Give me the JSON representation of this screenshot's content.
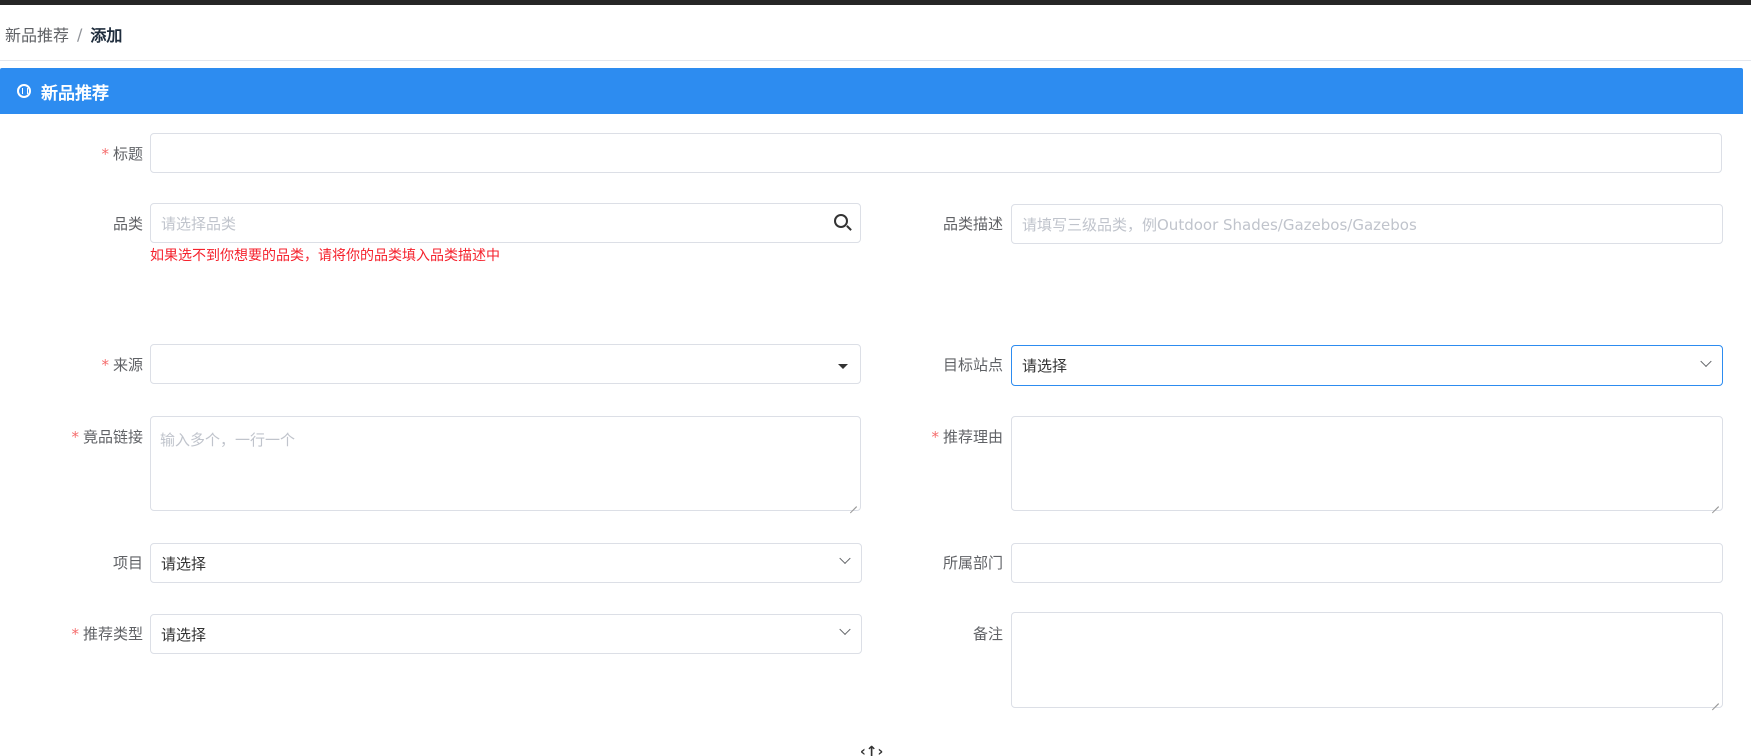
{
  "breadcrumb": {
    "parent": "新品推荐",
    "separator": "/",
    "current": "添加"
  },
  "panel": {
    "title": "新品推荐"
  },
  "form": {
    "title": {
      "label": "标题",
      "required": "*",
      "value": ""
    },
    "category": {
      "label": "品类",
      "placeholder": "请选择品类",
      "hint": "如果选不到你想要的品类，请将你的品类填入品类描述中"
    },
    "category_desc": {
      "label": "品类描述",
      "placeholder": "请填写三级品类，例Outdoor Shades/Gazebos/Gazebos"
    },
    "source": {
      "label": "来源",
      "required": "*",
      "value": ""
    },
    "target_site": {
      "label": "目标站点",
      "value": "请选择"
    },
    "competitor_links": {
      "label": "竟品链接",
      "required": "*",
      "placeholder": "输入多个，一行一个"
    },
    "reason": {
      "label": "推荐理由",
      "required": "*",
      "value": ""
    },
    "project": {
      "label": "项目",
      "value": "请选择"
    },
    "department": {
      "label": "所属部门",
      "value": ""
    },
    "recommend_type": {
      "label": "推荐类型",
      "required": "*",
      "value": "请选择"
    },
    "remark": {
      "label": "备注",
      "value": ""
    }
  },
  "colors": {
    "accent": "#2d8cf0",
    "error": "#f5222d",
    "required": "#f56c6c"
  },
  "icons": {
    "panel": "wordpress-icon",
    "search": "search-icon",
    "select": "chevron-down-icon",
    "bottom": "expand-icon"
  }
}
